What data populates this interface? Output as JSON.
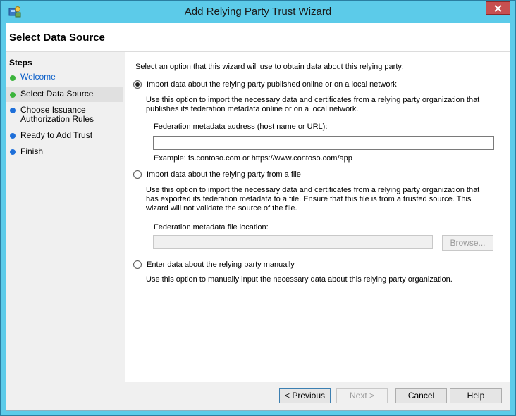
{
  "window": {
    "title": "Add Relying Party Trust Wizard"
  },
  "header": {
    "title": "Select Data Source"
  },
  "steps": {
    "heading": "Steps",
    "items": [
      {
        "label": "Welcome",
        "status": "done"
      },
      {
        "label": "Select Data Source",
        "status": "current"
      },
      {
        "label": "Choose Issuance Authorization Rules",
        "status": "pending"
      },
      {
        "label": "Ready to Add Trust",
        "status": "pending"
      },
      {
        "label": "Finish",
        "status": "pending"
      }
    ],
    "colors": {
      "done": "#3cb43c",
      "pending": "#1e6fd9"
    }
  },
  "content": {
    "intro": "Select an option that this wizard will use to obtain data about this relying party:",
    "option1": {
      "label": "Import data about the relying party published online or on a local network",
      "description": "Use this option to import the necessary data and certificates from a relying party organization that publishes its federation metadata online or on a local network.",
      "field_label": "Federation metadata address (host name or URL):",
      "field_value": "",
      "example": "Example: fs.contoso.com or https://www.contoso.com/app",
      "selected": true
    },
    "option2": {
      "label": "Import data about the relying party from a file",
      "description": "Use this option to import the necessary data and certificates from a relying party organization that has exported its federation metadata to a file. Ensure that this file is from a trusted source.  This wizard will not validate the source of the file.",
      "field_label": "Federation metadata file location:",
      "field_value": "",
      "browse_label": "Browse..."
    },
    "option3": {
      "label": "Enter data about the relying party manually",
      "description": "Use this option to manually input the necessary data about this relying party organization."
    }
  },
  "footer": {
    "previous": "< Previous",
    "next": "Next >",
    "cancel": "Cancel",
    "help": "Help"
  }
}
